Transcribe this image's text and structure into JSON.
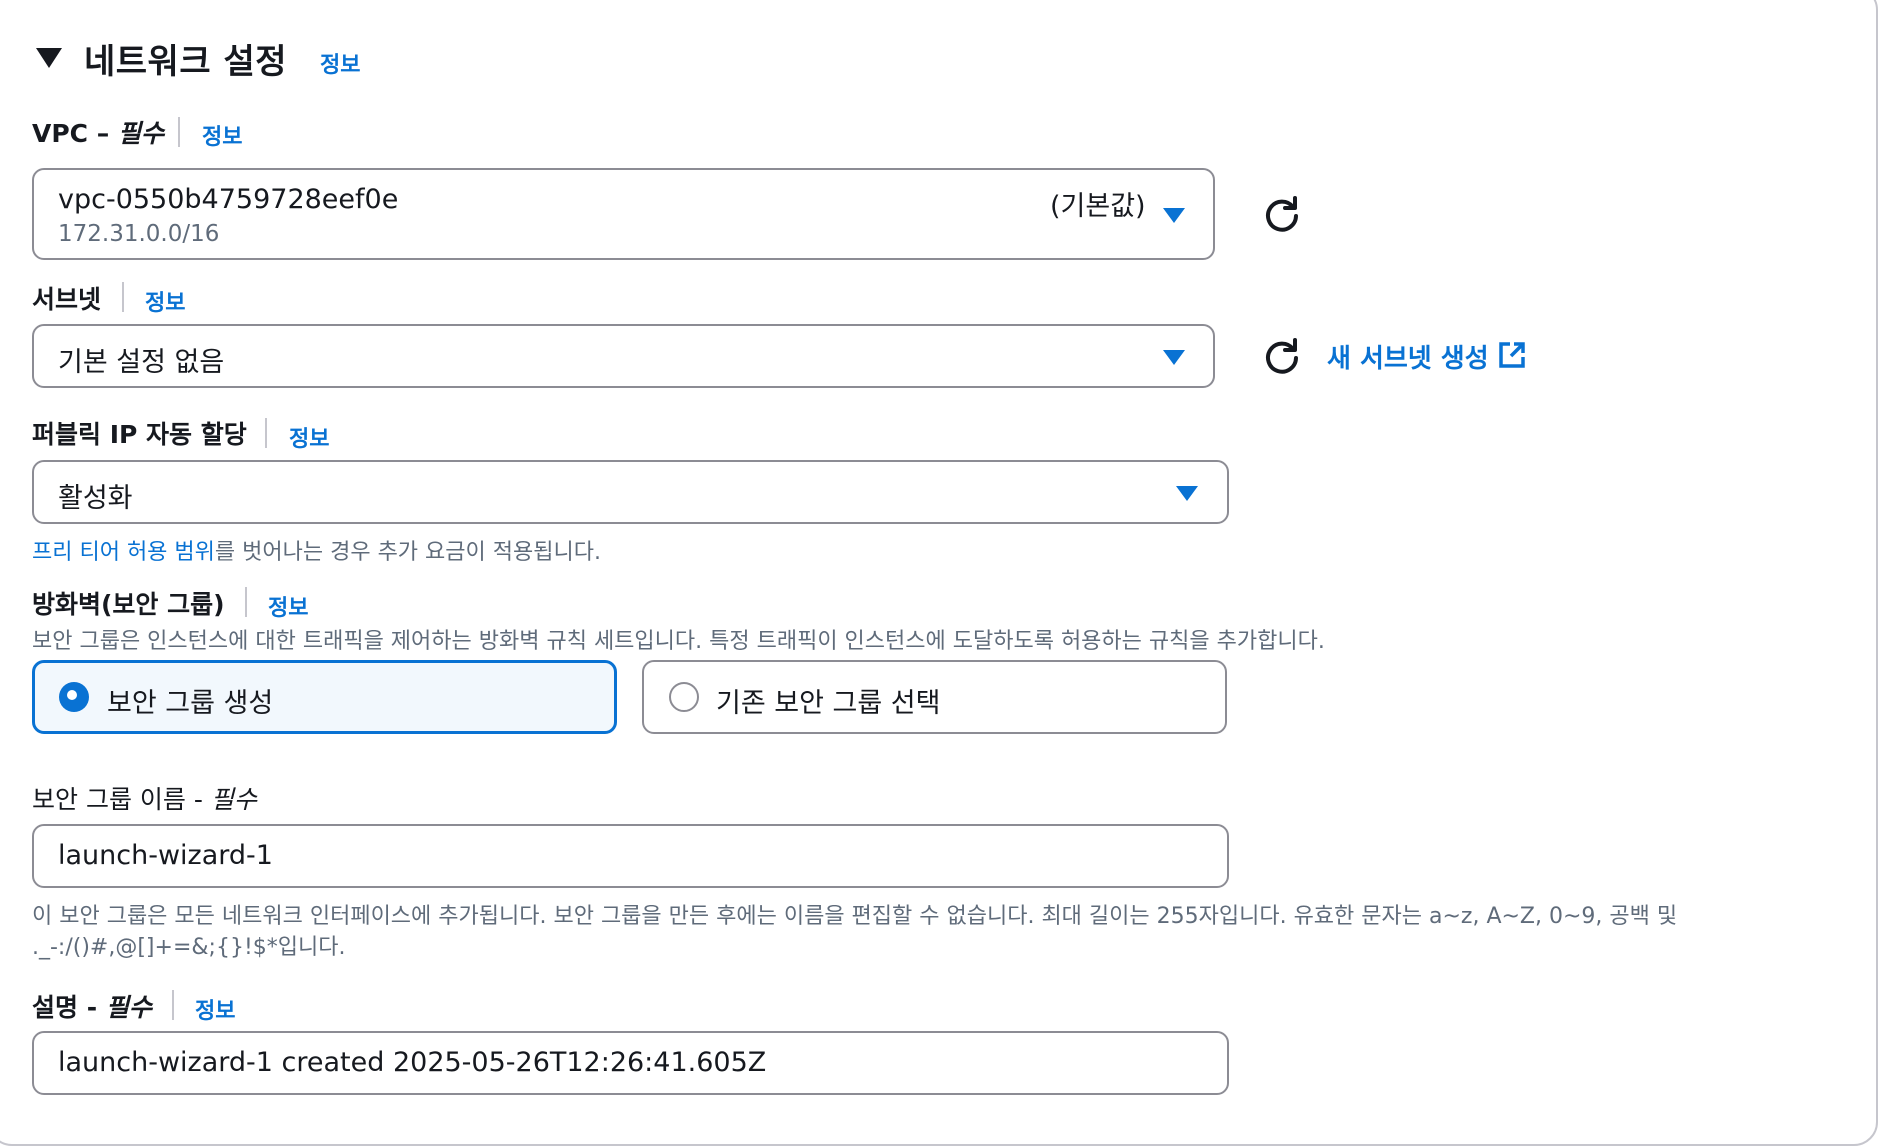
{
  "section": {
    "title": "네트워크 설정",
    "info": "정보"
  },
  "vpc": {
    "label": "VPC –",
    "required": "필수",
    "info": "정보",
    "value": "vpc-0550b4759728eef0e",
    "cidr": "172.31.0.0/16",
    "badge": "(기본값)"
  },
  "subnet": {
    "label": "서브넷",
    "info": "정보",
    "value": "기본 설정 없음",
    "create_link": "새 서브넷 생성"
  },
  "public_ip": {
    "label": "퍼블릭 IP 자동 할당",
    "info": "정보",
    "value": "활성화",
    "help_link": "프리 티어 허용 범위",
    "help_rest": "를 벗어나는 경우 추가 요금이 적용됩니다."
  },
  "firewall": {
    "label": "방화벽(보안 그룹)",
    "info": "정보",
    "description": "보안 그룹은 인스턴스에 대한 트래픽을 제어하는 방화벽 규칙 세트입니다. 특정 트래픽이 인스턴스에 도달하도록 허용하는 규칙을 추가합니다.",
    "options": [
      {
        "label": "보안 그룹 생성",
        "selected": true
      },
      {
        "label": "기존 보안 그룹 선택",
        "selected": false
      }
    ]
  },
  "sg_name": {
    "label": "보안 그룹 이름 -",
    "required": "필수",
    "value": "launch-wizard-1",
    "help_line1": "이 보안 그룹은 모든 네트워크 인터페이스에 추가됩니다. 보안 그룹을 만든 후에는 이름을 편집할 수 없습니다. 최대 길이는 255자입니다. 유효한 문자는 a~z, A~Z, 0~9, 공백 및",
    "help_line2": "._-:/()#,@[]+=&;{}!$*입니다."
  },
  "description_field": {
    "label": "설명 -",
    "required": "필수",
    "info": "정보",
    "value": "launch-wizard-1 created 2025-05-26T12:26:41.605Z"
  },
  "colors": {
    "link": "#0972d3",
    "selected_border": "#0972d3",
    "selected_bg": "#f2f8fd",
    "border": "#8c8c94",
    "text": "#16191f",
    "muted": "#5f6b7a"
  },
  "icons": {
    "section_toggle": "caret-down-icon",
    "refresh": "refresh-icon",
    "external": "external-link-icon",
    "dropdown": "dropdown-caret-icon"
  }
}
